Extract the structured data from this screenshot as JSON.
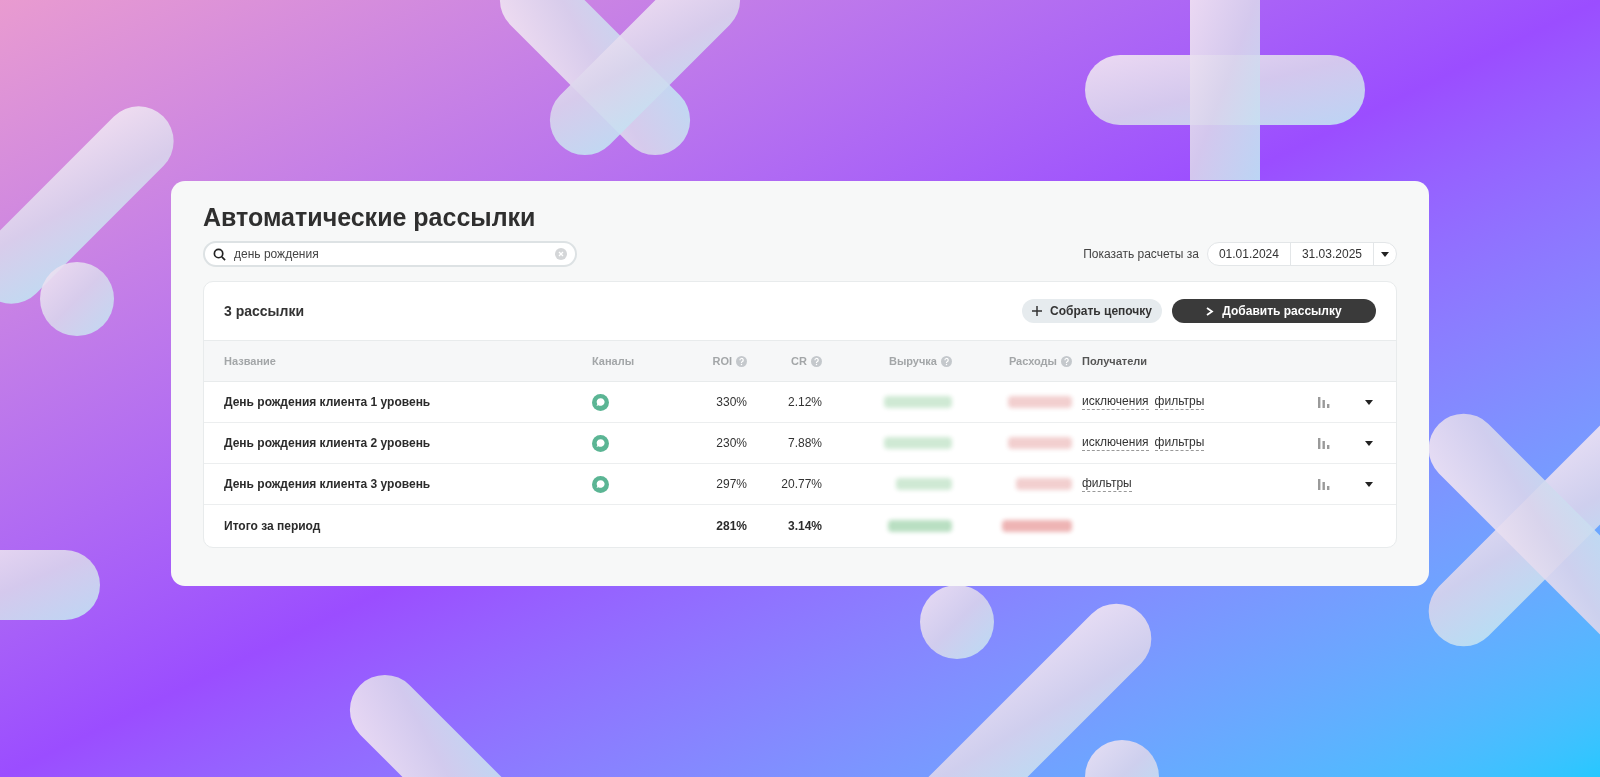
{
  "title": "Автоматические рассылки",
  "search": {
    "value": "день рождения"
  },
  "period": {
    "label": "Показать расчеты за",
    "from": "01.01.2024",
    "to": "31.03.2025"
  },
  "list": {
    "count_label": "3 рассылки",
    "buttons": [
      {
        "label": "Собрать цепочку",
        "kind": "secondary"
      },
      {
        "label": "Добавить рассылку",
        "kind": "primary"
      }
    ],
    "columns": [
      {
        "label": "Название",
        "help": false
      },
      {
        "label": "Каналы",
        "help": false
      },
      {
        "label": "ROI",
        "help": true
      },
      {
        "label": "CR",
        "help": true
      },
      {
        "label": "Выручка",
        "help": true
      },
      {
        "label": "Расходы",
        "help": true
      },
      {
        "label": "Получатели",
        "help": false
      }
    ],
    "rows": [
      {
        "name": "День рождения клиента 1 уровень",
        "roi": "330%",
        "cr": "2.12%",
        "recipients": [
          "исключения",
          "фильтры"
        ]
      },
      {
        "name": "День рождения клиента 2 уровень",
        "roi": "230%",
        "cr": "7.88%",
        "recipients": [
          "исключения",
          "фильтры"
        ]
      },
      {
        "name": "День рождения клиента 3 уровень",
        "roi": "297%",
        "cr": "20.77%",
        "recipients": [
          "фильтры"
        ]
      }
    ],
    "total": {
      "label": "Итого за период",
      "roi": "281%",
      "cr": "3.14%"
    }
  }
}
